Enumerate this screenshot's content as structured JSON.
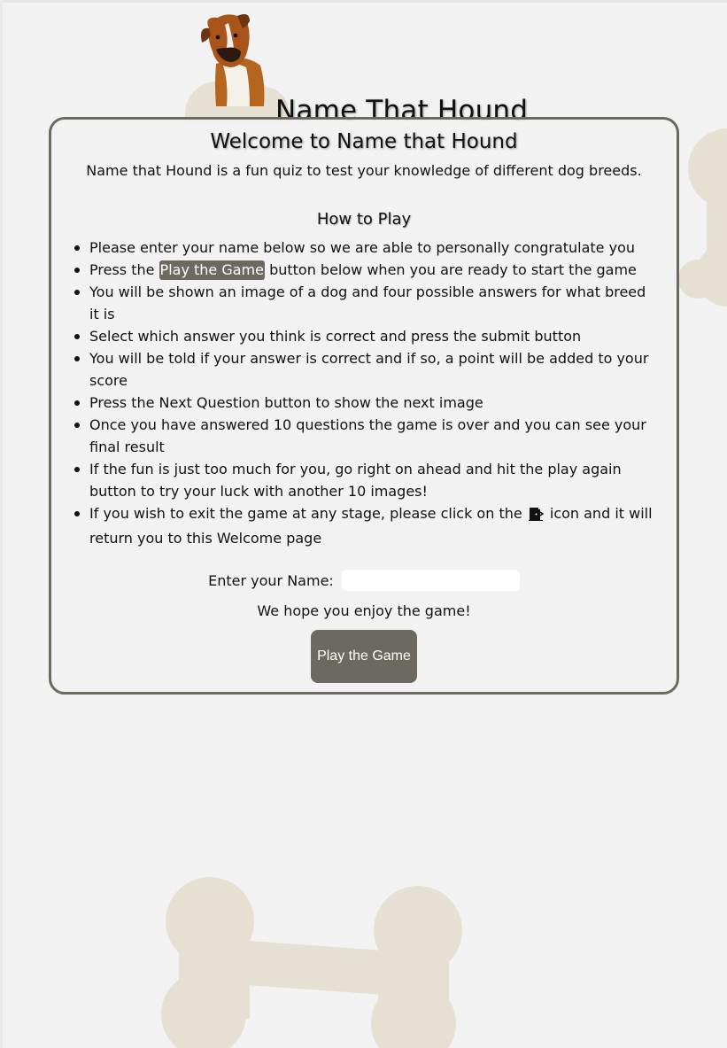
{
  "header": {
    "title": "Name That Hound",
    "logo_icon": "boxer-dog-icon"
  },
  "welcome": {
    "heading": "Welcome to Name that Hound",
    "intro": "Name that Hound is a fun quiz to test your knowledge of different dog breeds."
  },
  "how_to_play": {
    "heading": "How to Play",
    "steps": [
      {
        "text": "Please enter your name below so we are able to personally congratulate you"
      },
      {
        "before": "Press the ",
        "button_label": "Play the Game",
        "after": " button below when you are ready to start the game"
      },
      {
        "text": "You will be shown an image of a dog and four possible answers for what breed it is"
      },
      {
        "text": "Select which answer you think is correct and press the submit button"
      },
      {
        "text": "You will be told if your answer is correct and if so, a point will be added to your score"
      },
      {
        "text": "Press the Next Question button to show the next image"
      },
      {
        "text": "Once you have answered 10 questions the game is over and you can see your final result"
      },
      {
        "text": "If the fun is just too much for you, go right on ahead and hit the play again button to try your luck with another 10 images!"
      },
      {
        "before": "If you wish to exit the game at any stage, please click on the ",
        "icon": "door-exit-icon",
        "after": " icon and it will return you to this Welcome page"
      }
    ]
  },
  "form": {
    "name_label": "Enter your Name:",
    "name_value": "",
    "name_placeholder": "",
    "enjoy_text": "We hope you enjoy the game!",
    "play_button_label": "Play the Game"
  },
  "colors": {
    "background": "#f2f2f2",
    "accent": "#6b6960",
    "bone": "#e6e0d3"
  }
}
